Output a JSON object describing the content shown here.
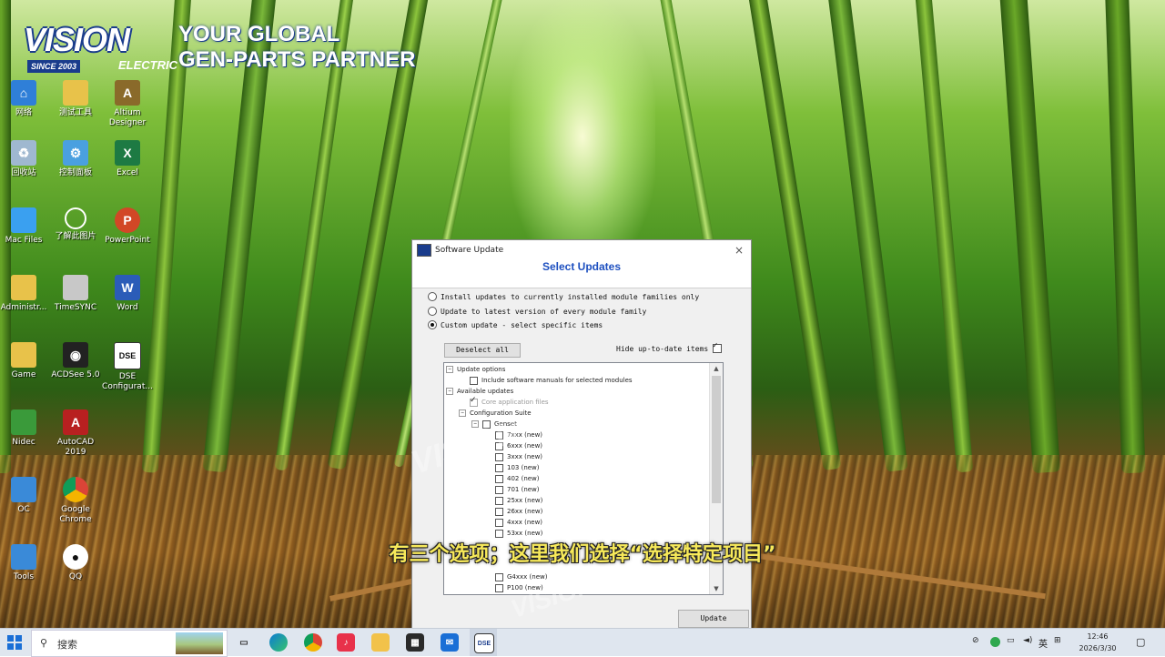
{
  "branding": {
    "logo_text": "VISION",
    "logo_sub": "SINCE 2003",
    "logo_sub2": "ELECTRIC",
    "tagline_line1": "YOUR GLOBAL",
    "tagline_line2": "GEN-PARTS PARTNER"
  },
  "desktop_icons": [
    {
      "label": "网络"
    },
    {
      "label": "测试工具"
    },
    {
      "label": "Altium Designer"
    },
    {
      "label": "回收站"
    },
    {
      "label": "控制面板"
    },
    {
      "label": "Excel"
    },
    {
      "label": "Mac Files"
    },
    {
      "label": "了解此图片"
    },
    {
      "label": "PowerPoint"
    },
    {
      "label": "Administr..."
    },
    {
      "label": "TimeSYNC"
    },
    {
      "label": "Word"
    },
    {
      "label": "Game"
    },
    {
      "label": "ACDSee 5.0"
    },
    {
      "label": "DSE Configurat..."
    },
    {
      "label": "Nidec"
    },
    {
      "label": "AutoCAD 2019"
    },
    {
      "label": "OC"
    },
    {
      "label": "Google Chrome"
    },
    {
      "label": "Tools"
    },
    {
      "label": "QQ"
    }
  ],
  "dialog": {
    "title": "Software Update",
    "close": "×",
    "header": "Select Updates",
    "options": [
      {
        "label": "Install updates to currently installed module families only",
        "selected": false
      },
      {
        "label": "Update to latest version of every module family",
        "selected": false
      },
      {
        "label": "Custom update - select specific items",
        "selected": true
      }
    ],
    "deselect_label": "Deselect all",
    "hide_label": "Hide up-to-date items",
    "hide_checked": true,
    "tree": {
      "update_options": "Update options",
      "include_manuals": "Include software manuals for selected modules",
      "available_updates": "Available updates",
      "core_files": "Core application files",
      "config_suite": "Configuration Suite",
      "genset": "Genset",
      "modules": [
        "7xxx (new)",
        "6xxx (new)",
        "3xxx (new)",
        "103 (new)",
        "402 (new)",
        "701 (new)",
        "25xx (new)",
        "26xx (new)",
        "4xxx (new)",
        "53xx (new)",
        "G4xxx (new)",
        "P100 (new)"
      ]
    },
    "update_button": "Update"
  },
  "subtitle": "有三个选项；这里我们选择“选择特定项目”",
  "taskbar": {
    "search_placeholder": "搜索",
    "tray_lang": "英",
    "time": "12:46",
    "date": "2026/3/30"
  }
}
